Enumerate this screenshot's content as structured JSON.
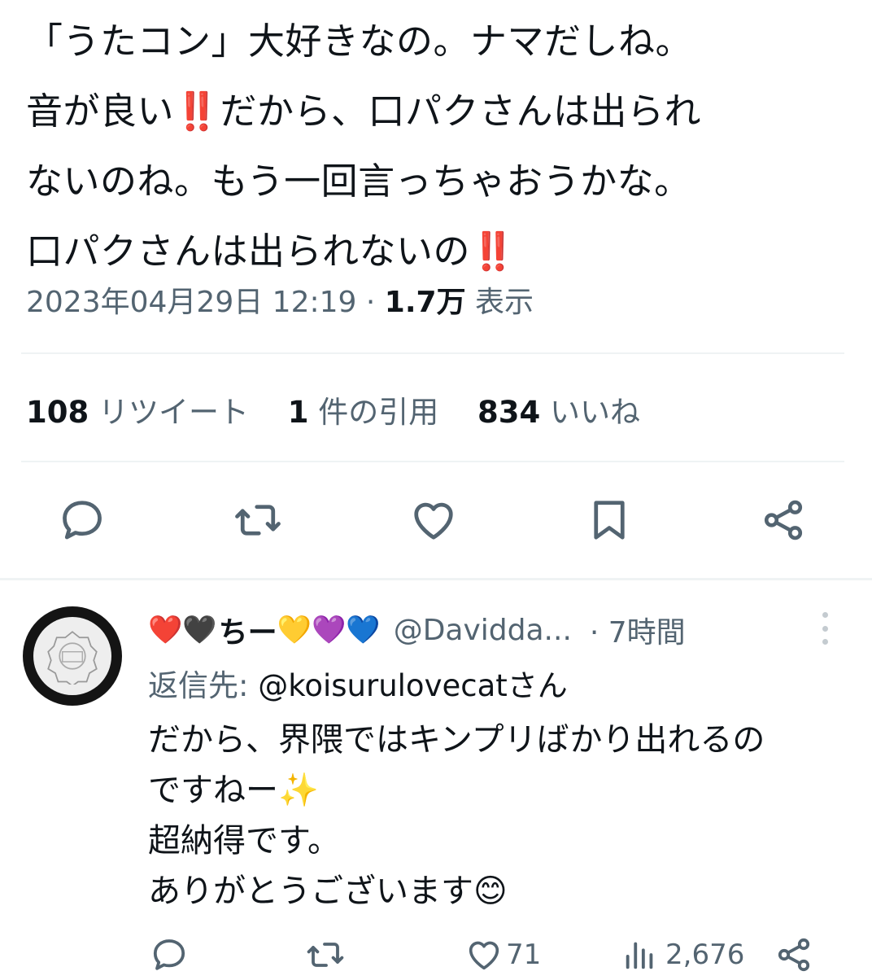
{
  "tweet": {
    "lines": [
      "「うたコン」大好きなの。ナマだしね。",
      "音が良い",
      "‼️",
      "だから、口パクさんは出られ",
      "ないのね。もう一回言っちゃおうかな。",
      "口パクさんは出られないの",
      "‼️"
    ],
    "timestamp": "2023年04月29日 12:19",
    "separator": "·",
    "views_count": "1.7万",
    "views_label": "表示"
  },
  "stats": {
    "retweets_count": "108",
    "retweets_label": "リツイート",
    "quotes_count": "1",
    "quotes_label": "件の引用",
    "likes_count": "834",
    "likes_label": "いいね"
  },
  "action_icons": [
    "reply-icon",
    "retweet-icon",
    "like-icon",
    "bookmark-icon",
    "share-icon"
  ],
  "reply": {
    "name_prefix_emojis": "❤️🖤",
    "name_text": "ちー",
    "name_suffix_emojis": "💛💜💙",
    "handle": "@Davidda...",
    "time": "· 7時間",
    "reply_to_label": "返信先:",
    "reply_to_mention": "@koisurulovecatさん",
    "body_lines": [
      "だから、界隈ではキンプリばかり出れるの",
      "ですねー✨",
      "超納得です。",
      "ありがとうございます😊"
    ],
    "likes": "71",
    "views": "2,676"
  },
  "colors": {
    "text": "#0f1419",
    "secondary": "#536471",
    "divider": "#eff3f4"
  }
}
